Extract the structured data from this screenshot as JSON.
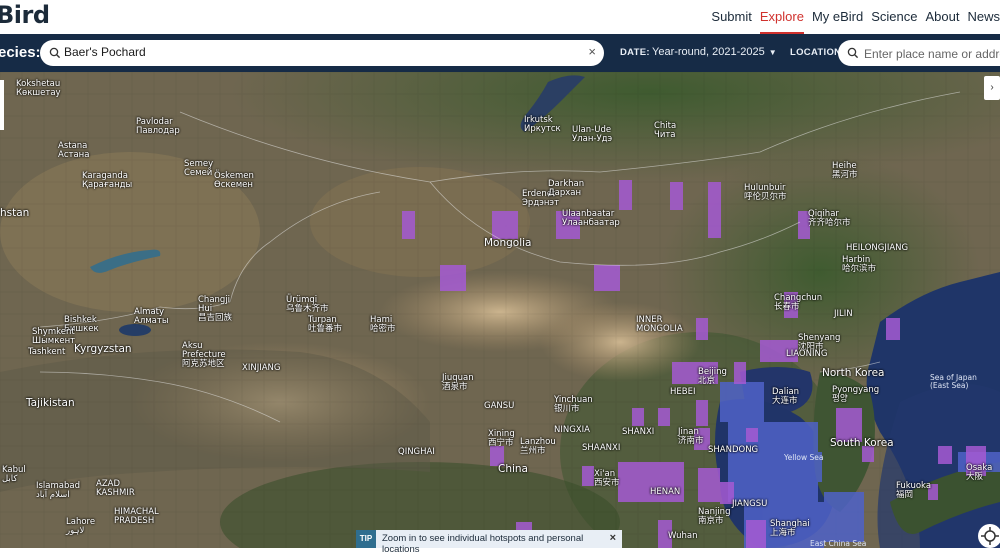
{
  "brand": {
    "logo_text": "Bird"
  },
  "nav": {
    "items": [
      "Submit",
      "Explore",
      "My eBird",
      "Science",
      "About",
      "News"
    ],
    "active": "Explore"
  },
  "filters": {
    "species_label": "ecies:",
    "species_value": "Baer's Pochard",
    "clear_symbol": "×",
    "date_label": "DATE:",
    "date_value": "Year-round, 2021-2025",
    "location_label": "LOCATION:",
    "location_placeholder": "Enter place name or address..."
  },
  "map_labels": {
    "kokshetau": "Kokshetau\nКөкшетау",
    "pavlodar": "Pavlodar\nПавлодар",
    "astana": "Astana\nАстана",
    "semey": "Semey\nСемей",
    "oskemen": "Öskemen\nӨскемен",
    "karaganda": "Karaganda\nҚарағанды",
    "kazakhstan": "hstan",
    "almaty": "Almaty\nАлматы",
    "bishkek": "Bishkek\nБишкек",
    "shymkent": "Shymkent\nШымкент",
    "tashkent": "Tashkent",
    "kyrgyzstan": "Kyrgyzstan",
    "tajikistan": "Tajikistan",
    "kabul": "Kabul\nکابل",
    "islamabad": "Islamabad\nاسلام آباد",
    "azad": "AZAD\nKASHMIR",
    "himachal": "HIMACHAL\nPRADESH",
    "lahore": "Lahore\nلاہور",
    "akesu": "Aksu\nPrefecture\n阿克苏地区",
    "xinjiang": "XINJIANG",
    "changji": "Changji\nHui\n昌吉回族",
    "urumqi": "Ürümqi\n乌鲁木齐市",
    "turpan": "Turpan\n吐鲁番市",
    "hami": "Hami\n哈密市",
    "qinghai": "QINGHAI",
    "irkutsk": "Irkutsk\nИркутск",
    "ulanude": "Ulan-Ude\nУлан-Удэ",
    "chita": "Chita\nЧита",
    "erdenet": "Erdenet\nЭрдэнэт",
    "darkhan": "Darkhan\nДархан",
    "mongolia": "Mongolia",
    "ulaanbaatar": "Ulaanbaatar\nУлаанбаатар",
    "hulunbuir": "Hulunbuir\n呼伦贝尔市",
    "heihe": "Heihe\n黑河市",
    "qiqihar": "Qiqihar\n齐齐哈尔市",
    "heilongjiang": "HEILONGJIANG",
    "harbin": "Harbin\n哈尔滨市",
    "changchun": "Changchun\n长春市",
    "jilin": "JILIN",
    "shenyang": "Shenyang\n沈阳市",
    "liaoning": "LIAONING",
    "inner_mongolia": "INNER\nMONGOLIA",
    "beijing": "Beijing\n北京",
    "hebei": "HEBEI",
    "dalian": "Dalian\n大连市",
    "north_korea": "North Korea",
    "pyongyang": "Pyongyang\n평양",
    "south_korea": "South Korea",
    "sea_of_japan": "Sea of Japan\n(East Sea)",
    "yellow_sea": "Yellow Sea",
    "yinchuan": "Yinchuan\n银川市",
    "ningxia": "NINGXIA",
    "gansu": "GANSU",
    "jiuquan": "Jiuquan\n酒泉市",
    "xining": "Xining\n西宁市",
    "lanzhou": "Lanzhou\n兰州市",
    "china": "China",
    "shanxi": "SHANXI",
    "shaanxi": "SHAANXI",
    "jinan": "Jinan\n济南市",
    "shandong": "SHANDONG",
    "xian": "Xi'an\n西安市",
    "henan": "HENAN",
    "jiangsu": "JIANGSU",
    "nanjing": "Nanjing\n南京市",
    "shanghai": "Shanghai\n上海市",
    "wuhan": "Wuhan",
    "fukuoka": "Fukuoka\n福岡",
    "osaka": "Osaka\n大阪",
    "east_china_sea": "East China Sea"
  },
  "tip": {
    "tag": "TIP",
    "message": "Zoom in to see individual hotspots and personal locations",
    "close": "×"
  },
  "colors": {
    "nav_bg": "#162b46",
    "active": "#d0312d",
    "occurrence_purple": "#a55ad3",
    "occurrence_blue": "#4f62c8"
  }
}
